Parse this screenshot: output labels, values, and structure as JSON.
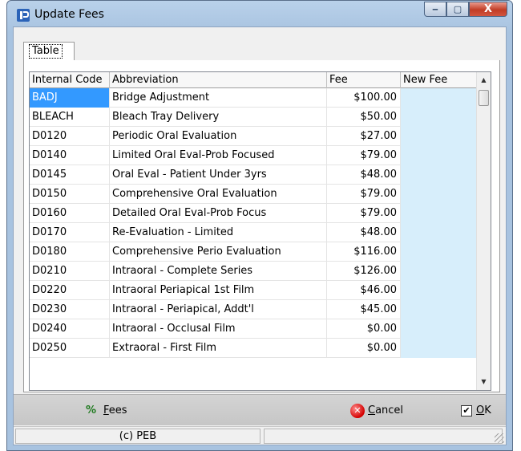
{
  "window": {
    "title": "Update Fees",
    "icon": "app-logo-icon",
    "controls": {
      "minimize": "‒",
      "maximize": "▢",
      "close": "X"
    }
  },
  "tabs": [
    {
      "label": "Table"
    }
  ],
  "table": {
    "columns": [
      "Internal Code",
      "Abbreviation",
      "Fee",
      "New Fee"
    ],
    "rows": [
      {
        "code": "BADJ",
        "abbr": "Bridge Adjustment",
        "fee": "$100.00",
        "new_fee": ""
      },
      {
        "code": "BLEACH",
        "abbr": "Bleach Tray Delivery",
        "fee": "$50.00",
        "new_fee": ""
      },
      {
        "code": "D0120",
        "abbr": "Periodic Oral Evaluation",
        "fee": "$27.00",
        "new_fee": ""
      },
      {
        "code": "D0140",
        "abbr": "Limited Oral Eval-Prob Focused",
        "fee": "$79.00",
        "new_fee": ""
      },
      {
        "code": "D0145",
        "abbr": "Oral Eval - Patient Under 3yrs",
        "fee": "$48.00",
        "new_fee": ""
      },
      {
        "code": "D0150",
        "abbr": "Comprehensive Oral Evaluation",
        "fee": "$79.00",
        "new_fee": ""
      },
      {
        "code": "D0160",
        "abbr": "Detailed Oral Eval-Prob Focus",
        "fee": "$79.00",
        "new_fee": ""
      },
      {
        "code": "D0170",
        "abbr": "Re-Evaluation - Limited",
        "fee": "$48.00",
        "new_fee": ""
      },
      {
        "code": "D0180",
        "abbr": "Comprehensive Perio Evaluation",
        "fee": "$116.00",
        "new_fee": ""
      },
      {
        "code": "D0210",
        "abbr": "Intraoral - Complete Series",
        "fee": "$126.00",
        "new_fee": ""
      },
      {
        "code": "D0220",
        "abbr": "Intraoral Periapical 1st Film",
        "fee": "$46.00",
        "new_fee": ""
      },
      {
        "code": "D0230",
        "abbr": "Intraoral - Periapical, Addt'l",
        "fee": "$45.00",
        "new_fee": ""
      },
      {
        "code": "D0240",
        "abbr": "Intraoral - Occlusal Film",
        "fee": "$0.00",
        "new_fee": ""
      },
      {
        "code": "D0250",
        "abbr": "Extraoral - First Film",
        "fee": "$0.00",
        "new_fee": ""
      }
    ]
  },
  "toolbar": {
    "fees": {
      "icon": "percent-fees-icon",
      "label_first": "F",
      "label_rest": "ees"
    },
    "cancel": {
      "icon": "cancel-icon",
      "label_first": "C",
      "label_rest": "ancel"
    },
    "ok": {
      "checked": true,
      "label_first": "O",
      "label_rest": "K"
    }
  },
  "status": {
    "left": "(c) PEB",
    "right": ""
  }
}
